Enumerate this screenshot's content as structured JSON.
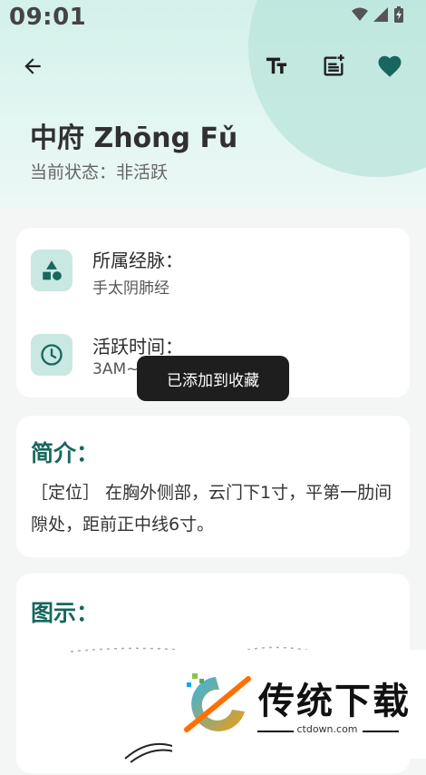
{
  "status_bar": {
    "time": "09:01"
  },
  "header": {
    "title": "中府 Zhōng Fǔ",
    "state_label": "当前状态：",
    "state_value": "非活跃",
    "icons": [
      "back-arrow-icon",
      "text-size-icon",
      "add-note-icon",
      "heart-icon"
    ]
  },
  "info_card": {
    "meridian_label": "所属经脉：",
    "meridian_value": "手太阴肺经",
    "time_label": "活跃时间：",
    "time_value": "3AM~5AM"
  },
  "intro_card": {
    "title": "简介：",
    "text": "［定位］ 在胸外侧部，云门下1寸，平第一肋间隙处，距前正中线6寸。"
  },
  "diagram_card": {
    "title": "图示："
  },
  "toast": {
    "text": "已添加到收藏"
  },
  "watermark": {
    "text": "传统下载",
    "url": "ctdown.com"
  },
  "colors": {
    "accent": "#17675e",
    "header_bg": "#d3f0ea",
    "icon_bg": "#c9e8e1"
  }
}
